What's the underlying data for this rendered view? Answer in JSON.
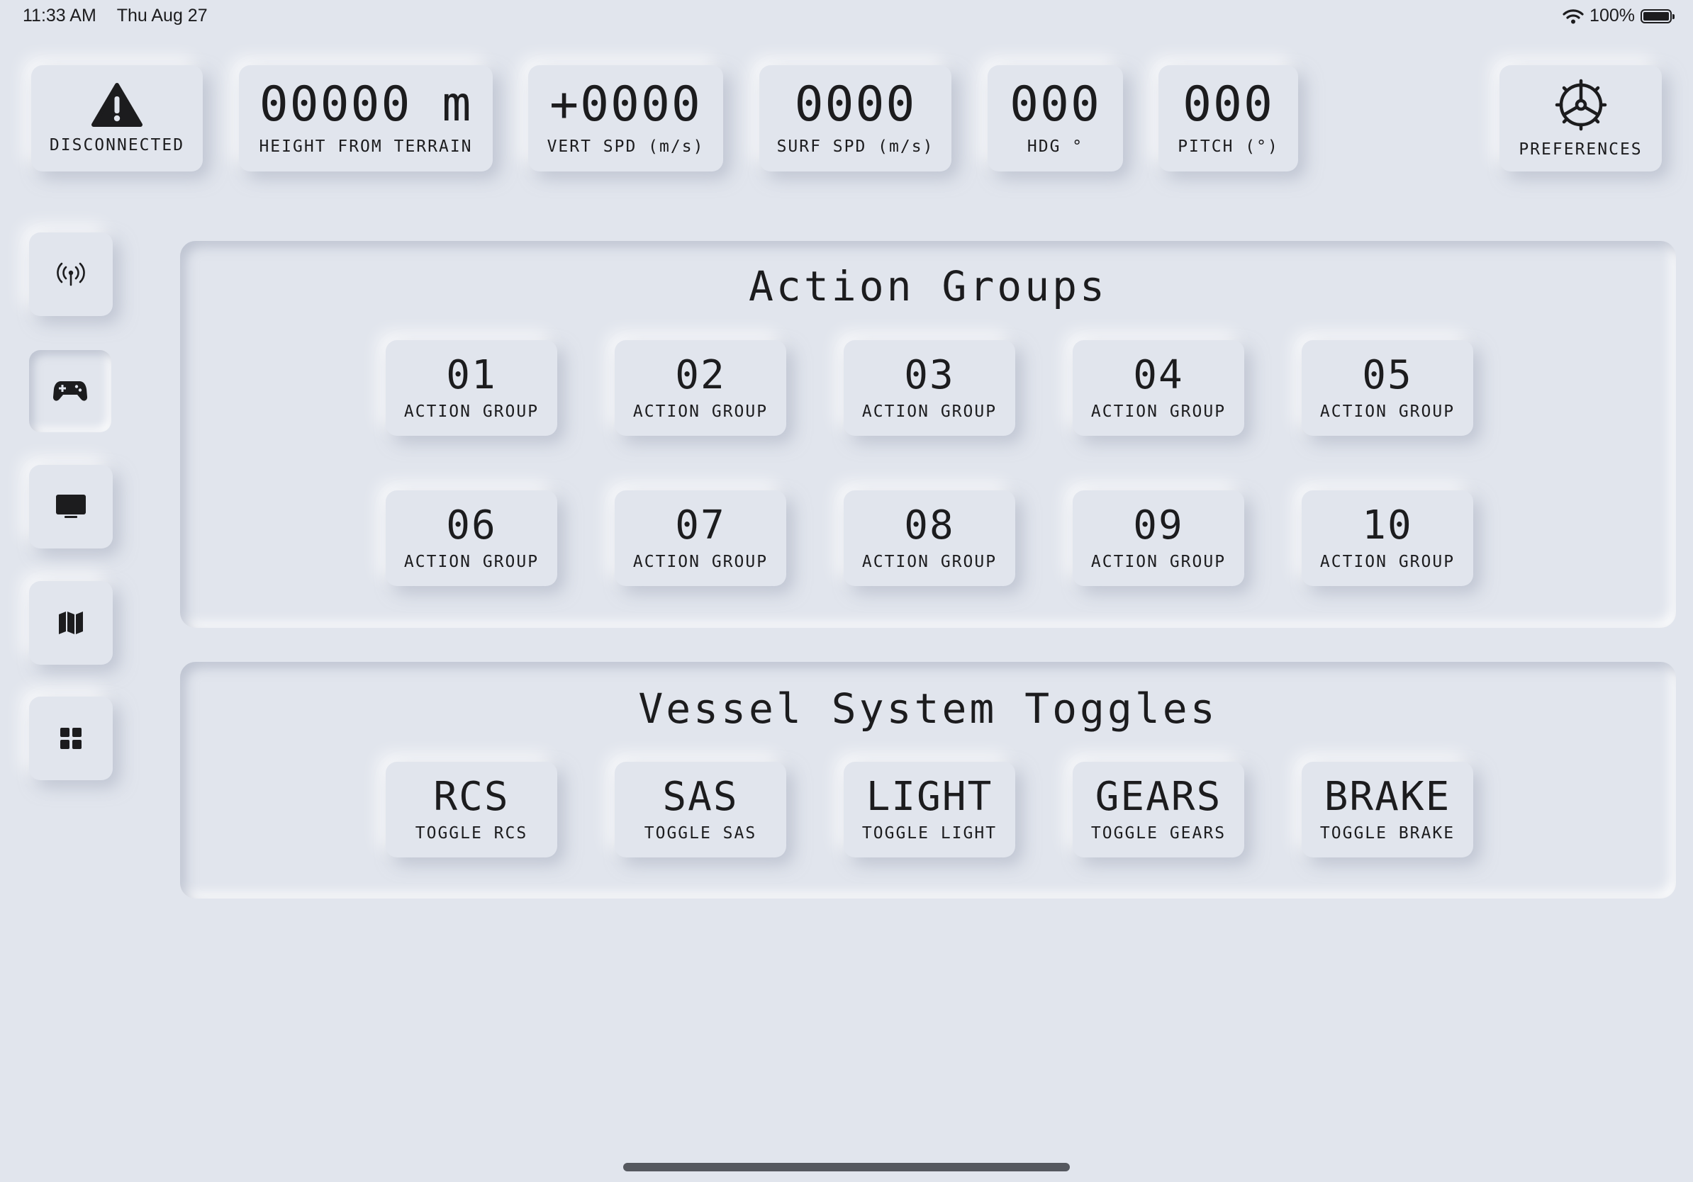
{
  "status_bar": {
    "time": "11:33 AM",
    "date": "Thu Aug 27",
    "battery": "100%"
  },
  "top_bar": {
    "connection": {
      "label": "DISCONNECTED",
      "icon": "warning-icon"
    },
    "height": {
      "value": "00000 m",
      "label": "HEIGHT FROM TERRAIN"
    },
    "vert_spd": {
      "value": "+0000",
      "label": "VERT SPD (m/s)"
    },
    "surf_spd": {
      "value": "0000",
      "label": "SURF SPD (m/s)"
    },
    "hdg": {
      "value": "000",
      "label": "HDG °"
    },
    "pitch": {
      "value": "000",
      "label": "PITCH (°)"
    },
    "preferences": {
      "label": "PREFERENCES",
      "icon": "helm-wheel-icon"
    }
  },
  "sidebar": {
    "items": [
      {
        "name": "telemetry",
        "icon": "antenna-icon"
      },
      {
        "name": "controls",
        "icon": "gamepad-icon",
        "active": true
      },
      {
        "name": "display",
        "icon": "monitor-icon"
      },
      {
        "name": "map",
        "icon": "map-icon"
      },
      {
        "name": "dashboard",
        "icon": "grid-icon"
      }
    ]
  },
  "action_groups": {
    "title": "Action Groups",
    "items": [
      {
        "number": "01",
        "label": "ACTION GROUP"
      },
      {
        "number": "02",
        "label": "ACTION GROUP"
      },
      {
        "number": "03",
        "label": "ACTION GROUP"
      },
      {
        "number": "04",
        "label": "ACTION GROUP"
      },
      {
        "number": "05",
        "label": "ACTION GROUP"
      },
      {
        "number": "06",
        "label": "ACTION GROUP"
      },
      {
        "number": "07",
        "label": "ACTION GROUP"
      },
      {
        "number": "08",
        "label": "ACTION GROUP"
      },
      {
        "number": "09",
        "label": "ACTION GROUP"
      },
      {
        "number": "10",
        "label": "ACTION GROUP"
      }
    ]
  },
  "vessel_toggles": {
    "title": "Vessel System Toggles",
    "items": [
      {
        "name": "RCS",
        "label": "TOGGLE RCS"
      },
      {
        "name": "SAS",
        "label": "TOGGLE SAS"
      },
      {
        "name": "LIGHT",
        "label": "TOGGLE LIGHT"
      },
      {
        "name": "GEARS",
        "label": "TOGGLE GEARS"
      },
      {
        "name": "BRAKE",
        "label": "TOGGLE BRAKE"
      }
    ]
  }
}
